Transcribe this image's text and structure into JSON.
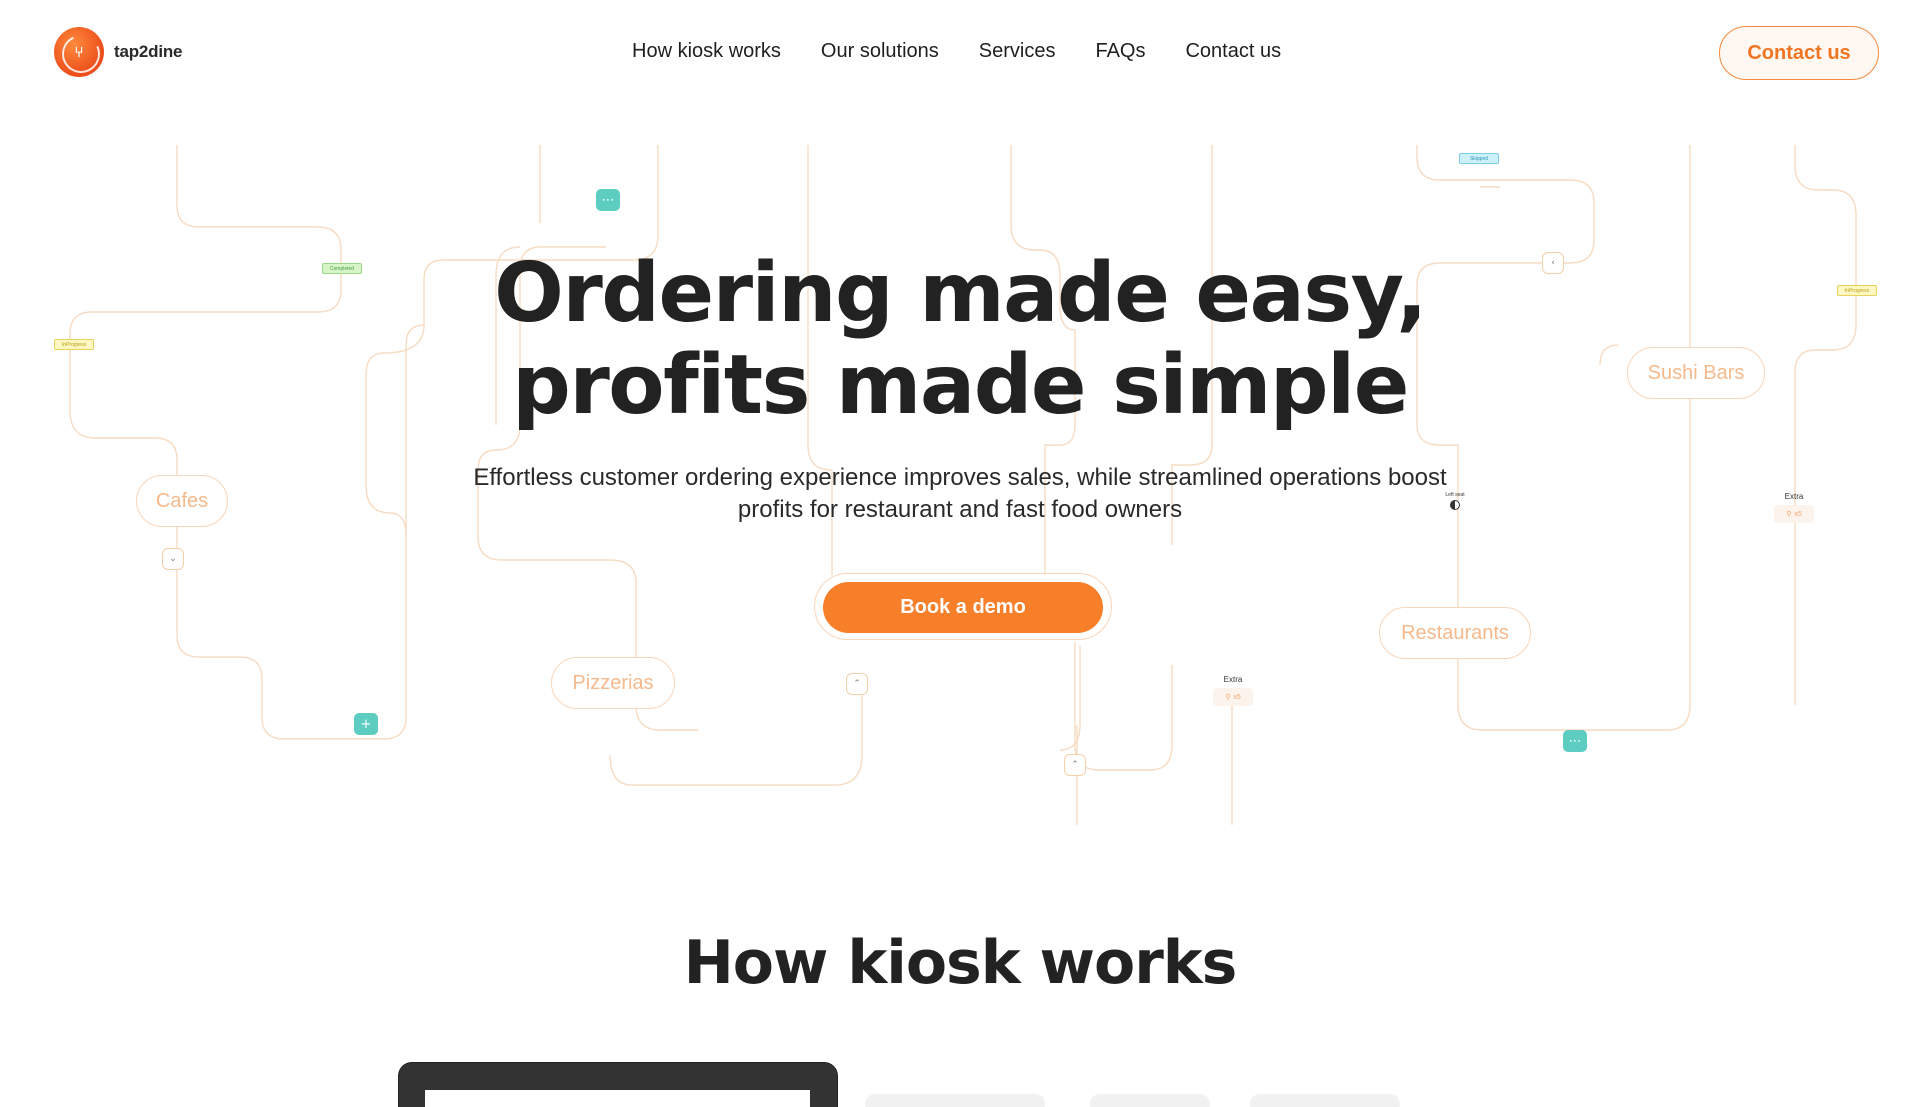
{
  "brand": {
    "name": "tap2dine",
    "accent": "#f87f2a",
    "teal": "#5ecdc1"
  },
  "nav": {
    "items": [
      "How kiosk works",
      "Our solutions",
      "Services",
      "FAQs",
      "Contact us"
    ],
    "contact_button": "Contact us"
  },
  "hero": {
    "title_line1": "Ordering made easy,",
    "title_line2": "profits made simple",
    "subtitle": "Effortless customer ordering experience improves sales, while streamlined operations boost profits for restaurant and fast food owners",
    "cta": "Book a demo"
  },
  "flow": {
    "tags": {
      "cafes": "Cafes",
      "pizzerias": "Pizzerias",
      "restaurants": "Restaurants",
      "sushi": "Sushi Bars"
    },
    "mini_labels": {
      "completed": "Completed",
      "inprogress": "InProgress",
      "skipped": "Skipped",
      "inprogress_right": "InProgress",
      "left_seat": "Left seat"
    },
    "extra_label": "Extra",
    "extra_value": "x5",
    "icons": [
      "plus-icon",
      "more-dots-icon",
      "chevron-down-icon",
      "chevron-up-icon",
      "chevron-left-icon",
      "user-icon"
    ]
  },
  "section": {
    "title": "How kiosk works"
  }
}
